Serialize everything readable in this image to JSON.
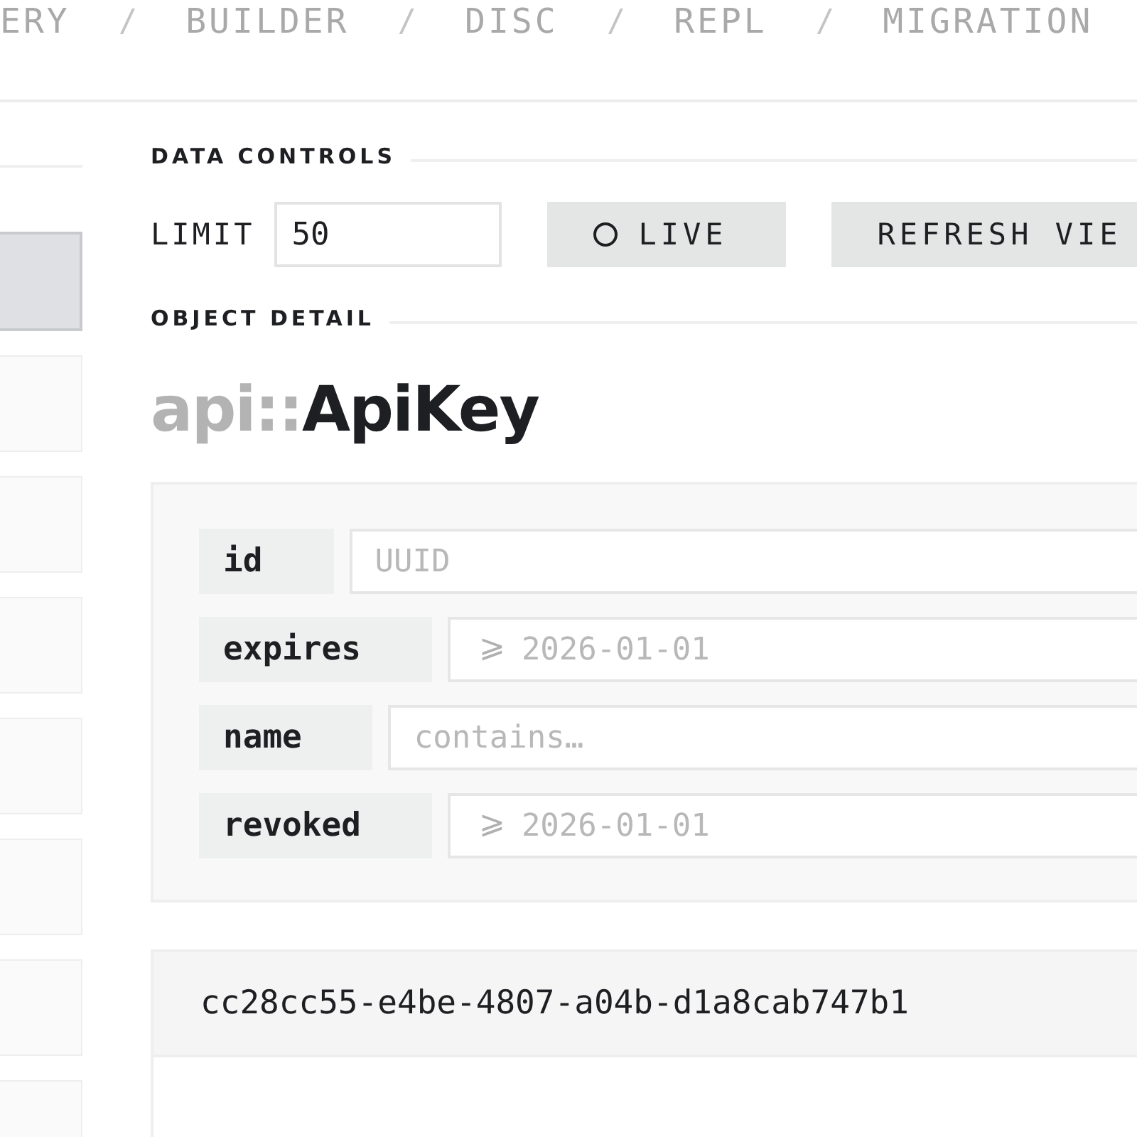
{
  "nav": [
    {
      "label": "ERY",
      "selected": false
    },
    {
      "label": "BUILDER",
      "selected": false
    },
    {
      "label": "DISC",
      "selected": false
    },
    {
      "label": "REPL",
      "selected": false
    },
    {
      "label": "MIGRATION",
      "selected": false
    }
  ],
  "nav_separator": "/",
  "sidebar": {
    "items": [
      {
        "selected": true
      },
      {
        "selected": false
      },
      {
        "selected": false
      },
      {
        "selected": false
      },
      {
        "selected": false
      },
      {
        "selected": false
      },
      {
        "selected": false
      },
      {
        "selected": false
      }
    ]
  },
  "data_controls": {
    "heading": "DATA CONTROLS",
    "limit_label": "LIMIT",
    "limit_value": "50",
    "live": {
      "label": "LIVE",
      "on": false
    },
    "refresh_label": "REFRESH VIE"
  },
  "object_detail": {
    "heading": "OBJECT DETAIL",
    "namespace": "api::",
    "name": "ApiKey",
    "filters": [
      {
        "label": "id",
        "placeholder": "UUID"
      },
      {
        "label": "expires",
        "placeholder": "2026-01-01",
        "prefix": "⩾"
      },
      {
        "label": "name",
        "placeholder": "contains…"
      },
      {
        "label": "revoked",
        "placeholder": "2026-01-01",
        "prefix": "⩾"
      }
    ]
  },
  "records": [
    {
      "id": "cc28cc55-e4be-4807-a04b-d1a8cab747b1"
    }
  ]
}
